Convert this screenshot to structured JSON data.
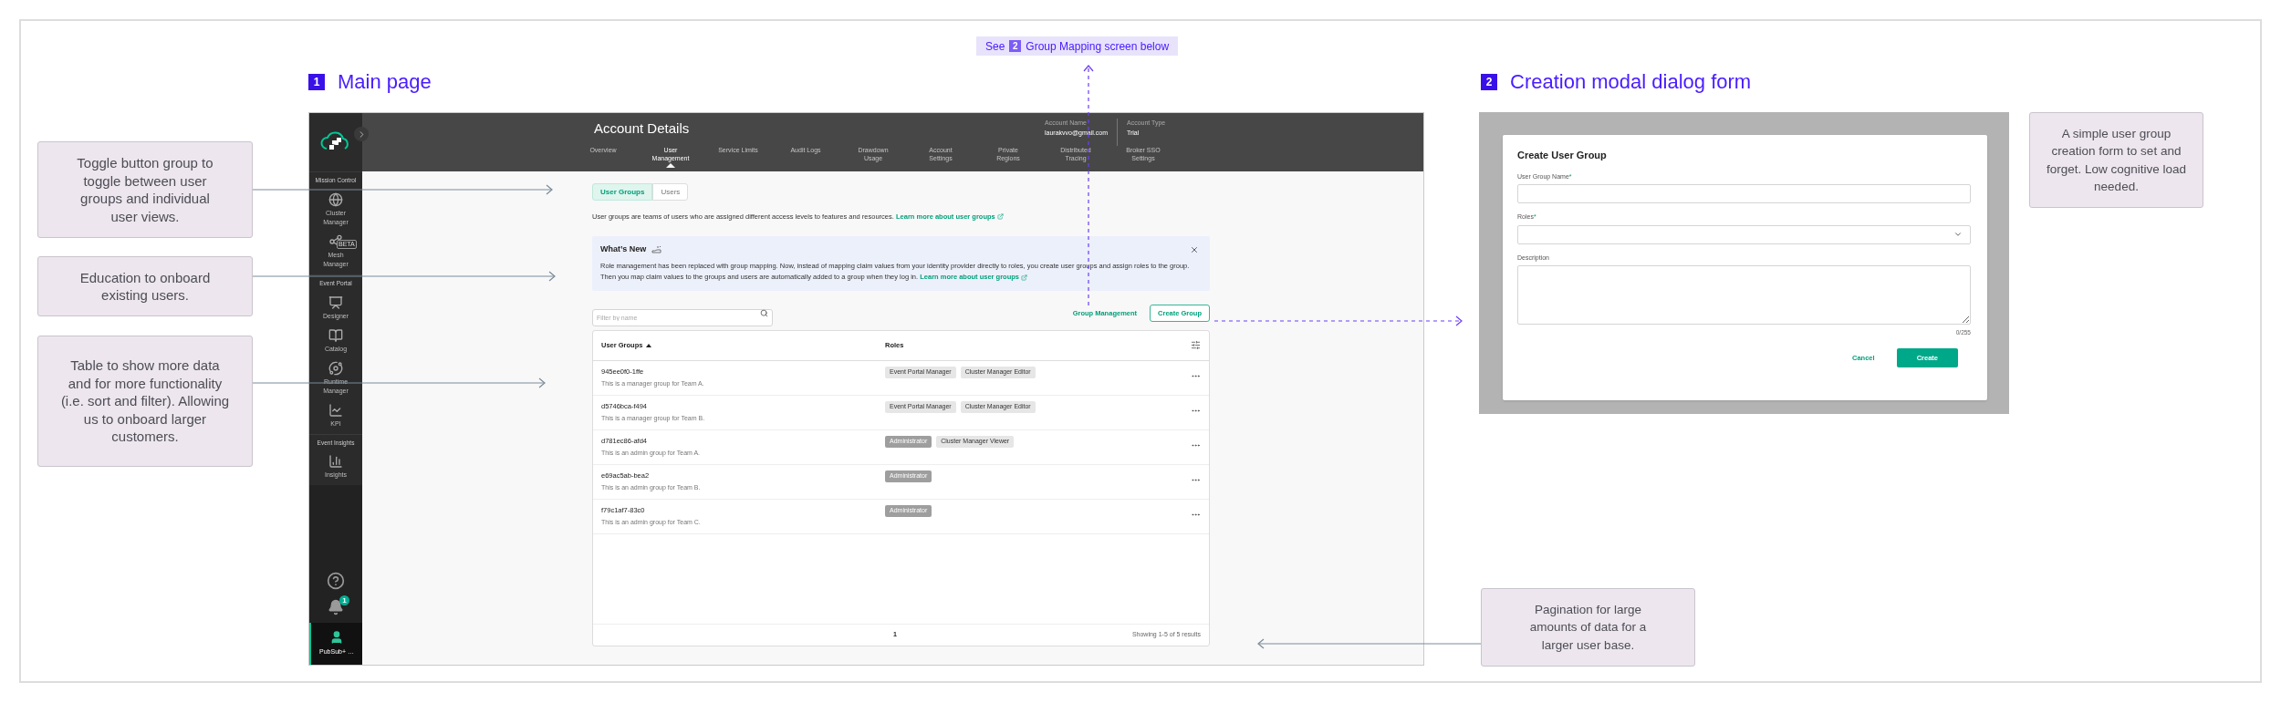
{
  "reference_tag": {
    "prefix": "See",
    "number": "2",
    "text": "Group Mapping screen below"
  },
  "sections": [
    {
      "number": "1",
      "title": "Main page"
    },
    {
      "number": "2",
      "title": "Creation modal dialog form"
    }
  ],
  "callouts": [
    {
      "text": "Toggle button group to toggle between user groups and individual user views."
    },
    {
      "text": "Education to onboard existing users."
    },
    {
      "text": "Table to show more data and for more functionality (i.e. sort and filter). Allowing us to onboard larger customers."
    },
    {
      "text": "A simple user group creation form to set and forget. Low cognitive load needed."
    },
    {
      "text": "Pagination for large amounts of data for a larger user base."
    }
  ],
  "app": {
    "sidebar": {
      "sections": [
        {
          "label": "Mission Control",
          "items": [
            {
              "label": "Cluster Manager"
            },
            {
              "label": "Mesh Manager",
              "badge": "BETA"
            }
          ]
        },
        {
          "label": "Event Portal",
          "items": [
            {
              "label": "Designer"
            },
            {
              "label": "Catalog"
            },
            {
              "label": "Runtime Manager"
            },
            {
              "label": "KPI"
            }
          ]
        },
        {
          "label": "Event Insights",
          "items": [
            {
              "label": "Insights"
            }
          ]
        }
      ],
      "notification_count": "1",
      "user": {
        "label": "PubSub+ …",
        "selected": true
      }
    },
    "header": {
      "title": "Account Details",
      "info": [
        {
          "label": "Account Name",
          "value": "laurakvvo@gmail.com"
        },
        {
          "label": "Account Type",
          "value": "Trial"
        }
      ],
      "tabs": [
        {
          "label": "Overview",
          "selected": false
        },
        {
          "label": "User Management",
          "selected": true
        },
        {
          "label": "Service Limits",
          "selected": false
        },
        {
          "label": "Audit Logs",
          "selected": false
        },
        {
          "label": "Drawdown Usage",
          "selected": false
        },
        {
          "label": "Account Settings",
          "selected": false
        },
        {
          "label": "Private Regions",
          "selected": false
        },
        {
          "label": "Distributed Tracing",
          "selected": false
        },
        {
          "label": "Broker SSO Settings",
          "selected": false
        }
      ]
    },
    "content": {
      "toggle": [
        {
          "label": "User Groups",
          "selected": true
        },
        {
          "label": "Users",
          "selected": false
        }
      ],
      "intro": {
        "text": "User groups are teams of users who are assigned different access levels to features and resources.",
        "link": "Learn more about user groups"
      },
      "whats_new": {
        "title": "What’s New",
        "text": "Role management has been replaced with group mapping. Now, instead of mapping claim values from your identity provider directly to roles, you create user groups and assign roles to the group. Then you map claim values to the groups and users are automatically added to a group when they log in.",
        "link": "Learn more about user groups"
      },
      "filter": {
        "placeholder": "Filter by name"
      },
      "actions": {
        "secondary": "Group Management",
        "primary": "Create Group"
      },
      "table": {
        "columns": [
          {
            "label": "User Groups",
            "sorted": true
          },
          {
            "label": "Roles",
            "sorted": false
          }
        ],
        "rows": [
          {
            "name": "945ee0f0-1ffe",
            "description": "This is a manager group for Team A.",
            "roles": [
              {
                "label": "Event Portal Manager",
                "kind": "standard"
              },
              {
                "label": "Cluster Manager Editor",
                "kind": "standard"
              }
            ]
          },
          {
            "name": "d5746bca-f494",
            "description": "This is a manager group for Team B.",
            "roles": [
              {
                "label": "Event Portal Manager",
                "kind": "standard"
              },
              {
                "label": "Cluster Manager Editor",
                "kind": "standard"
              }
            ]
          },
          {
            "name": "d781ec86-afd4",
            "description": "This is an admin group for Team A.",
            "roles": [
              {
                "label": "Administrator",
                "kind": "admin"
              },
              {
                "label": "Cluster Manager Viewer",
                "kind": "standard"
              }
            ]
          },
          {
            "name": "e69ac5ab-bea2",
            "description": "This is an admin group for Team B.",
            "roles": [
              {
                "label": "Administrator",
                "kind": "admin"
              }
            ]
          },
          {
            "name": "f79c1af7-83c0",
            "description": "This is an admin group for Team C.",
            "roles": [
              {
                "label": "Administrator",
                "kind": "admin"
              }
            ]
          }
        ],
        "page": "1",
        "summary": "Showing 1-5 of 5 results"
      }
    }
  },
  "modal": {
    "title": "Create User Group",
    "required_mark": "*",
    "fields": [
      {
        "label": "User Group Name",
        "kind": "text",
        "required": true
      },
      {
        "label": "Roles",
        "kind": "select",
        "required": true
      },
      {
        "label": "Description",
        "kind": "textarea",
        "required": false,
        "counter": "0/255"
      }
    ],
    "buttons": {
      "cancel": "Cancel",
      "confirm": "Create"
    }
  }
}
